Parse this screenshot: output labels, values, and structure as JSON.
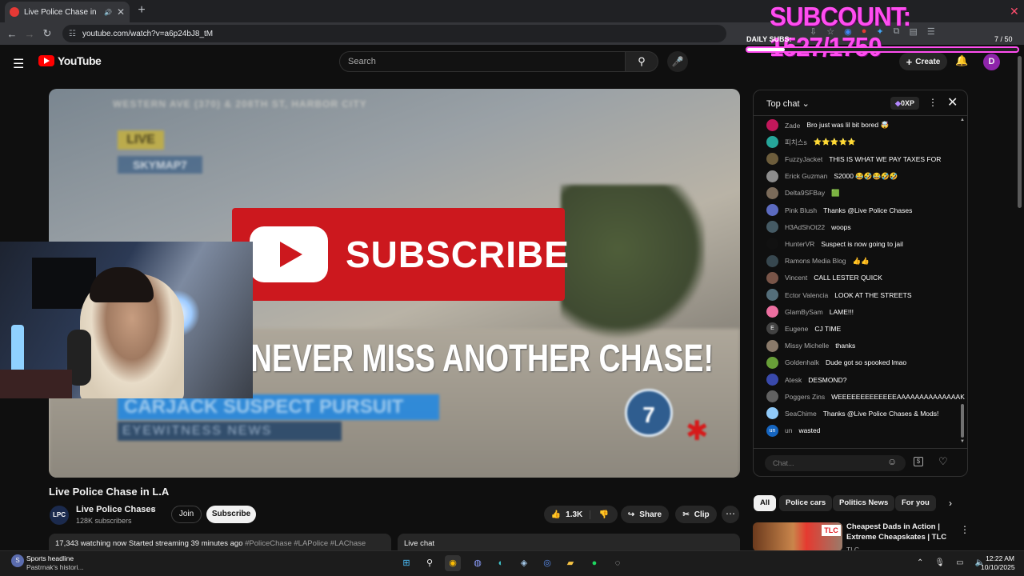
{
  "browser": {
    "tab_title": "Live Police Chase in LA - Yo",
    "url": "youtube.com/watch?v=a6p24bJ8_tM"
  },
  "overlay": {
    "subcount": "SUBCOUNT: 1527/1750",
    "daily_label": "DAILY SUBS:",
    "daily_count": "7 / 50",
    "daily_progress": 0.14,
    "accent": "#ff4df0"
  },
  "header": {
    "logo_text": "YouTube",
    "search_placeholder": "Search",
    "create_label": "Create",
    "avatar_letter": "D"
  },
  "video": {
    "street_overlay": "WESTERN AVE (370) & 208TH ST, HARBOR CITY",
    "live_badge": "LIVE",
    "sky_badge": "SKYMAP7",
    "subscribe_banner": "SUBSCRIBE",
    "headline": "NEVER MISS ANOTHER CHASE!",
    "lower_third": "CARJACK SUSPECT PURSUIT",
    "lower_third_sub": "EYEWITNESS NEWS",
    "station_logo": "7"
  },
  "watch": {
    "title": "Live Police Chase in L.A",
    "channel": "Live Police Chases",
    "channel_logo": "LPC",
    "subscribers": "128K subscribers",
    "join": "Join",
    "subscribe": "Subscribe",
    "likes": "1.3K",
    "share": "Share",
    "clip": "Clip",
    "description": "17,343 watching now  Started streaming 39 minutes ago ",
    "tags": "#PoliceChase #LAPolice #LAChase",
    "live_chat_label": "Live chat"
  },
  "chat": {
    "mode": "Top chat",
    "xp": "0XP",
    "input_placeholder": "Chat...",
    "messages": [
      {
        "name": "Zade",
        "text": "Bro just was lil bit bored 🤯",
        "color": "#c2185b"
      },
      {
        "name": "피치스s",
        "text": "⭐⭐⭐⭐⭐",
        "color": "#26a69a"
      },
      {
        "name": "FuzzyJacket",
        "text": "THIS IS WHAT WE PAY TAXES FOR",
        "color": "#6d5d3c"
      },
      {
        "name": "Erick Guzman",
        "text": "S2000 😂🤣😂🤣🤣",
        "color": "#8d8d8d"
      },
      {
        "name": "Delta9SFBay",
        "text": "🟩",
        "color": "#7b6b5a"
      },
      {
        "name": "Pink Blush",
        "text": "Thanks @Live Police Chases",
        "color": "#5c6bc0"
      },
      {
        "name": "H3AdShOt22",
        "text": "woops",
        "color": "#455a64"
      },
      {
        "name": "HunterVR",
        "text": "Suspect is now going to jail",
        "color": "#111111"
      },
      {
        "name": "Ramons Media Blog",
        "text": "👍👍",
        "color": "#37474f"
      },
      {
        "name": "Vincent",
        "text": "CALL LESTER QUICK",
        "color": "#795548"
      },
      {
        "name": "Ector Valencia",
        "text": "LOOK AT THE STREETS",
        "color": "#546e7a"
      },
      {
        "name": "GlamBySam",
        "text": "LAME!!!",
        "color": "#ec6fa0"
      },
      {
        "name": "Eugene",
        "text": "CJ TIME",
        "color": "#424242",
        "initial": "E"
      },
      {
        "name": "Missy Michelle",
        "text": "thanks",
        "color": "#8a7a6a"
      },
      {
        "name": "Goldenhalk",
        "text": "Dude got so spooked lmao",
        "color": "#689f38"
      },
      {
        "name": "Atesk",
        "text": "DESMOND?",
        "color": "#3949ab"
      },
      {
        "name": "Poggers Zins",
        "text": "WEEEEEEEEEEEEEAAAAAAAAAAAAAAK",
        "color": "#616161"
      },
      {
        "name": "SeaChime",
        "text": "Thanks @Live Police Chases & Mods!",
        "color": "#90caf9"
      },
      {
        "name": "un",
        "text": "wasted",
        "color": "#1565c0",
        "initial": "un"
      }
    ]
  },
  "chips": [
    "All",
    "Police cars",
    "Politics News",
    "For you"
  ],
  "recommended": {
    "title": "Cheapest Dads in Action | Extreme Cheapskates | TLC",
    "channel": "TLC",
    "badge": "TLC"
  },
  "taskbar": {
    "news_title": "Sports headline",
    "news_sub": "Pastrnak's histori...",
    "time": "12:22 AM",
    "date": "10/10/2025"
  }
}
